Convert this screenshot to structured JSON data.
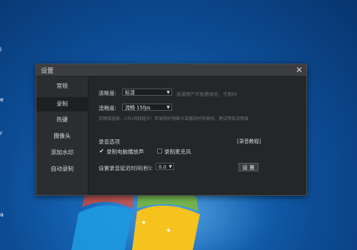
{
  "desktop": {
    "edge_labels": [
      "l",
      "e",
      "r",
      "a"
    ]
  },
  "window": {
    "title": "设置",
    "close_glyph": "✕"
  },
  "sidebar": {
    "items": [
      {
        "label": "常规"
      },
      {
        "label": "录制"
      },
      {
        "label": "热键"
      },
      {
        "label": "摄像头"
      },
      {
        "label": "添加水印"
      },
      {
        "label": "自动录制"
      }
    ],
    "active_index": 1
  },
  "settings": {
    "clarity_label": "清晰度:",
    "clarity_value": "标清",
    "clarity_hint": "普通用户可免费体验，不限时",
    "fluency_label": "流畅度:",
    "fluency_value": "流畅 15fps",
    "fluency_hint": "流畅度越高，CPU消耗越大）若录制时电脑卡或播放时有跳帧，建议降低流畅度",
    "audio_section_label": "录音选项",
    "audio_tutorial_link": "[录音教程]",
    "record_system_sound_label": "录制电脑播放声",
    "record_system_sound_checked": true,
    "record_mic_label": "录制麦克风",
    "record_mic_checked": false,
    "delay_label": "设置录音延迟时间(秒):",
    "delay_value": "0.0",
    "setup_button": "设 置"
  },
  "colors": {
    "window_bg": "#242628",
    "sidebar_bg": "#2b2d30",
    "titlebar_bg": "#3b3d40",
    "accent_logo": [
      "#e8452c",
      "#7fbb2a",
      "#1e9ae0",
      "#f6c21d"
    ]
  }
}
